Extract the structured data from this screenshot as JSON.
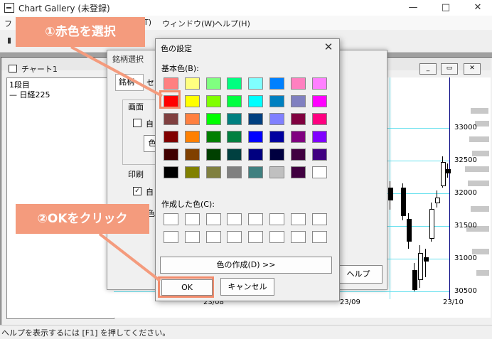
{
  "window": {
    "title": "Chart Gallery (未登録)",
    "minimize": "—",
    "maximize": "□",
    "close": "✕"
  },
  "menu": {
    "items": [
      "フ",
      "T)",
      "ウィンドウ(W)",
      "ヘルプ(H)"
    ]
  },
  "chart_window": {
    "title": "チャート1",
    "minimize": "_",
    "maximize": "▭",
    "close": "✕",
    "left_panel": {
      "line1": "1段目",
      "line2": "— 日経225"
    },
    "y_ticks": [
      "33000",
      "32500",
      "32000",
      "31500",
      "31000",
      "30500"
    ],
    "x_ticks": [
      "23/08",
      "23/09",
      "23/10"
    ]
  },
  "stock_dialog": {
    "title": "銘柄選択",
    "tab_label": "銘柄",
    "tab2": "セ",
    "group1_label": "画面",
    "checkbox1": "自",
    "button1": "色",
    "group2_label": "印刷",
    "checkbox2": "自",
    "checkbox2_checked": "✓",
    "label3": "色",
    "help_button": "ヘルプ"
  },
  "color_dialog": {
    "title": "色の設定",
    "close": "✕",
    "basic_colors_label": "基本色(B):",
    "custom_colors_label": "作成した色(C):",
    "define_custom_button": "色の作成(D) >>",
    "ok_button": "OK",
    "cancel_button": "キャンセル",
    "basic_colors": [
      "#ff8080",
      "#ffff80",
      "#80ff80",
      "#00ff80",
      "#80ffff",
      "#0080ff",
      "#ff80c0",
      "#ff80ff",
      "#ff0000",
      "#ffff00",
      "#80ff00",
      "#00ff40",
      "#00ffff",
      "#0080c0",
      "#8080c0",
      "#ff00ff",
      "#804040",
      "#ff8040",
      "#00ff00",
      "#008080",
      "#004080",
      "#8080ff",
      "#800040",
      "#ff0080",
      "#800000",
      "#ff8000",
      "#008000",
      "#008040",
      "#0000ff",
      "#0000a0",
      "#800080",
      "#8000ff",
      "#400000",
      "#804000",
      "#004000",
      "#004040",
      "#000080",
      "#000040",
      "#400040",
      "#400080",
      "#000000",
      "#808000",
      "#808040",
      "#808080",
      "#408080",
      "#c0c0c0",
      "#400040",
      "#ffffff"
    ],
    "selected_index": 8
  },
  "callouts": {
    "step1": "①赤色を選択",
    "step2": "②OKをクリック",
    "color": "#f49b7d"
  },
  "status_bar": {
    "text": "ヘルプを表示するには [F1] を押してください。"
  }
}
